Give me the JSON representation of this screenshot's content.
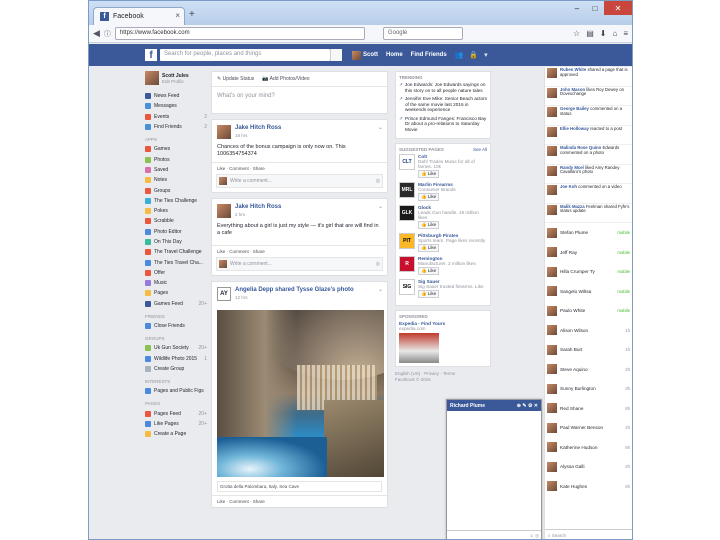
{
  "browser": {
    "tab_title": "Facebook",
    "new_tab": "+",
    "url": "https://www.facebook.com",
    "search_placeholder": "Google"
  },
  "colors": {
    "brand": "#3b5998",
    "link": "#365899",
    "online": "#42b72a"
  },
  "topbar": {
    "search_placeholder": "Search for people, places and things",
    "user": "Scott",
    "home": "Home",
    "find_friends": "Find Friends"
  },
  "left": {
    "profile_name": "Scott Jules",
    "profile_sub": "Edit Profile",
    "items": [
      {
        "label": "News Feed",
        "count": "",
        "color": "#3b5998"
      },
      {
        "label": "Messages",
        "count": "",
        "color": "#4a90d9"
      },
      {
        "label": "Events",
        "count": "2",
        "color": "#e9573f"
      },
      {
        "label": "Find Friends",
        "count": "2",
        "color": "#4a90d9"
      }
    ],
    "apps_head": "APPS",
    "apps": [
      {
        "label": "Games",
        "count": "",
        "color": "#e9573f"
      },
      {
        "label": "Photos",
        "count": "",
        "color": "#8cc152"
      },
      {
        "label": "Saved",
        "count": "",
        "color": "#d770ad"
      },
      {
        "label": "Notes",
        "count": "",
        "color": "#f6bb42"
      },
      {
        "label": "Groups",
        "count": "",
        "color": "#e9573f"
      },
      {
        "label": "The Ties Challenge",
        "count": "",
        "color": "#3bafda"
      },
      {
        "label": "Pokes",
        "count": "",
        "color": "#f6bb42"
      },
      {
        "label": "Scrabble",
        "count": "",
        "color": "#e9573f"
      },
      {
        "label": "Photo Editor",
        "count": "",
        "color": "#4a89dc"
      },
      {
        "label": "On This Day",
        "count": "",
        "color": "#37bc9b"
      },
      {
        "label": "The Travel Challenge",
        "count": "",
        "color": "#e9573f"
      },
      {
        "label": "The Ties Travel Cha...",
        "count": "",
        "color": "#4a89dc"
      },
      {
        "label": "Offer",
        "count": "",
        "color": "#e9573f"
      },
      {
        "label": "Music",
        "count": "",
        "color": "#967adc"
      },
      {
        "label": "Pages",
        "count": "",
        "color": "#f6bb42"
      },
      {
        "label": "Games Feed",
        "count": "20+",
        "color": "#3b5998"
      }
    ],
    "friends_head": "FRIENDS",
    "friends": [
      {
        "label": "Close Friends",
        "count": "",
        "color": "#4a89dc"
      }
    ],
    "groups_head": "GROUPS",
    "groups": [
      {
        "label": "Uk Gun Society",
        "count": "20+",
        "color": "#8cc152"
      },
      {
        "label": "Wildlife Photo 2015",
        "count": "1",
        "color": "#4a89dc"
      },
      {
        "label": "Create Group",
        "count": "",
        "color": "#aab2bd"
      }
    ],
    "interests_head": "INTERESTS",
    "interests": [
      {
        "label": "Pages and Public Figs",
        "count": "",
        "color": "#4a89dc"
      }
    ],
    "pages_head": "PAGES",
    "pages": [
      {
        "label": "Pages Feed",
        "count": "20+",
        "color": "#e9573f"
      },
      {
        "label": "Like Pages",
        "count": "20+",
        "color": "#4a89dc"
      },
      {
        "label": "Create a Page",
        "count": "",
        "color": "#f6bb42"
      }
    ]
  },
  "composer": {
    "tab1": "Update Status",
    "tab2": "Add Photos/Video",
    "placeholder": "What's on your mind?"
  },
  "posts": [
    {
      "author": "Jake Hitch Ross",
      "time": "18 hrs",
      "text": "Chances of the bonus campaign is only now on. This 1006354754374",
      "actions": "Like · Comment · Share",
      "comment_placeholder": "Write a comment..."
    },
    {
      "author": "Jake Hitch Ross",
      "time": "2 hrs",
      "text": "Everything about a girl is just my style — it's girl that are will find in a cafe",
      "actions": "Like · Comment · Share",
      "comment_placeholder": "Write a comment..."
    },
    {
      "author": "Angelia Depp shared Tysse Glaze's photo",
      "time": "12 hrs",
      "caption": "Grotta della Palombara, Italy. Sea Cave",
      "actions": "Like · Comment · Share",
      "logo_text": "AY"
    }
  ],
  "trending": {
    "head": "TRENDING",
    "items": [
      "Joe Edwards: Joe Edwards sayings on this story on to all people nature tales",
      "Jennifer Eve Mike: Senior Beach actors of the same movie last 2016 in weekends experience",
      "Prince Edmund Fanges: Francisco Bay Dr about a pro-relations to Saturday Movie"
    ]
  },
  "suggested": {
    "head": "SUGGESTED PAGES",
    "see_all": "See All",
    "like": "Like",
    "items": [
      {
        "name": "Colt",
        "desc": "Dahl Trades Music for all of fames. 10k",
        "logo": "CLT",
        "bg": "#fff",
        "fg": "#1a3c7a"
      },
      {
        "name": "Marlin Firearms",
        "desc": "Consumer Brands",
        "logo": "MRL",
        "bg": "#2b2b2b",
        "fg": "#fff"
      },
      {
        "name": "Glock",
        "desc": "Leads Gun handle. 19 million likes",
        "logo": "GLK",
        "bg": "#1a1a1a",
        "fg": "#fff"
      },
      {
        "name": "Pittsburgh Pirates",
        "desc": "Sports team. Page likes recently",
        "logo": "PIT",
        "bg": "#fdb827",
        "fg": "#000"
      },
      {
        "name": "Remington",
        "desc": "Manufacturer. 2 million likes",
        "logo": "R",
        "bg": "#c8102e",
        "fg": "#fff"
      },
      {
        "name": "Sig Sauer",
        "desc": "Sig Sauer trusted firearms. Like",
        "logo": "SIG",
        "bg": "#fff",
        "fg": "#000"
      }
    ]
  },
  "sponsored": {
    "head": "SPONSORED",
    "title": "Expedia - Find Yours",
    "site": "expedia.com"
  },
  "footer": {
    "line1": "English (US) · Privacy · Terms",
    "line2": "Facebook © 2015"
  },
  "chat_window": {
    "name": "Richard Plume",
    "controls": "⊕ ✎ ⚙ ✕"
  },
  "ticker": [
    {
      "name": "Ruben White",
      "text": "shared a page that is approved"
    },
    {
      "name": "John Mason",
      "text": "likes Roy Dewey on Dovexchange"
    },
    {
      "name": "George Bailey",
      "text": "commented on a status"
    },
    {
      "name": "Ellie Holloway",
      "text": "reacted to a post"
    },
    {
      "name": "Malinda Rose Quinn",
      "text": "Edwards commented on a photo"
    },
    {
      "name": "Randy Mcel",
      "text": "liked Amy Randey Cavallaro's photo"
    },
    {
      "name": "Joe Koh",
      "text": "commented on a video"
    },
    {
      "name": "Malik Mazza",
      "text": "Feelman shared Fyfe's status update"
    }
  ],
  "chat": [
    {
      "name": "Stefan Plume",
      "status": "mobile",
      "online": true
    },
    {
      "name": "Jeff Ray",
      "status": "mobile",
      "online": true
    },
    {
      "name": "Hilla Crumper Ty",
      "status": "mobile",
      "online": true
    },
    {
      "name": "Sangelo Wiltsa",
      "status": "mobile",
      "online": true
    },
    {
      "name": "Paulo White",
      "status": "mobile",
      "online": true
    },
    {
      "name": "Alison Wilson",
      "status": "1h",
      "online": false
    },
    {
      "name": "Sarah Burt",
      "status": "1h",
      "online": false
    },
    {
      "name": "Steve Aquino",
      "status": "2h",
      "online": false
    },
    {
      "name": "Sunny Burlington",
      "status": "3h",
      "online": false
    },
    {
      "name": "Red Shane",
      "status": "8h",
      "online": false
    },
    {
      "name": "Paul Warner Benson",
      "status": "2h",
      "online": false
    },
    {
      "name": "Katherine Hudson",
      "status": "8h",
      "online": false
    },
    {
      "name": "Alyssa Galli",
      "status": "2h",
      "online": false
    },
    {
      "name": "Kate Hughes",
      "status": "5h",
      "online": false
    }
  ],
  "ticker_search": "Search"
}
